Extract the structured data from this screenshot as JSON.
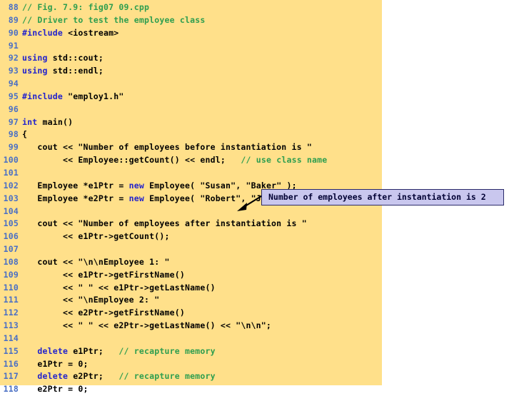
{
  "page": {
    "background_color": "#ffffff",
    "code_background_color": "#ffe08a",
    "linenum_color": "#4a6fc4",
    "keyword_color": "#2222cc",
    "comment_color": "#2e9e4f",
    "text_color": "#000000"
  },
  "callout": {
    "text": "Number of employees after instantiation is 2",
    "background_color": "#c9c7ee",
    "border_color": "#2a2a6a",
    "text_color": "#000033"
  },
  "code": {
    "lines": [
      {
        "number": "88",
        "tokens": [
          {
            "t": "// Fig. 7.9: fig07 09.cpp",
            "c": "cmt"
          }
        ]
      },
      {
        "number": "89",
        "tokens": [
          {
            "t": "// Driver to test the employee class",
            "c": "cmt"
          }
        ]
      },
      {
        "number": "90",
        "tokens": [
          {
            "t": "#include",
            "c": "pre"
          },
          {
            "t": " <iostream>",
            "c": "plain"
          }
        ]
      },
      {
        "number": "91",
        "tokens": []
      },
      {
        "number": "92",
        "tokens": [
          {
            "t": "using",
            "c": "kw"
          },
          {
            "t": " std::cout;",
            "c": "plain"
          }
        ]
      },
      {
        "number": "93",
        "tokens": [
          {
            "t": "using",
            "c": "kw"
          },
          {
            "t": " std::endl;",
            "c": "plain"
          }
        ]
      },
      {
        "number": "94",
        "tokens": []
      },
      {
        "number": "95",
        "tokens": [
          {
            "t": "#include",
            "c": "pre"
          },
          {
            "t": " \"employ1.h\"",
            "c": "plain"
          }
        ]
      },
      {
        "number": "96",
        "tokens": []
      },
      {
        "number": "97",
        "tokens": [
          {
            "t": "int",
            "c": "kw"
          },
          {
            "t": " main()",
            "c": "plain"
          }
        ]
      },
      {
        "number": "98",
        "tokens": [
          {
            "t": "{",
            "c": "plain"
          }
        ]
      },
      {
        "number": "99",
        "tokens": [
          {
            "t": "   cout << \"Number of employees before instantiation is \"",
            "c": "plain"
          }
        ]
      },
      {
        "number": "100",
        "tokens": [
          {
            "t": "        << Employee::getCount() << endl;   ",
            "c": "plain"
          },
          {
            "t": "// use class name",
            "c": "cmt"
          }
        ]
      },
      {
        "number": "101",
        "tokens": []
      },
      {
        "number": "102",
        "tokens": [
          {
            "t": "   Employee *e1Ptr = ",
            "c": "plain"
          },
          {
            "t": "new",
            "c": "kw"
          },
          {
            "t": " Employee( \"Susan\", \"Baker\" );",
            "c": "plain"
          }
        ]
      },
      {
        "number": "103",
        "tokens": [
          {
            "t": "   Employee *e2Ptr = ",
            "c": "plain"
          },
          {
            "t": "new",
            "c": "kw"
          },
          {
            "t": " Employee( \"Robert\", \"Jones\" );",
            "c": "plain"
          }
        ]
      },
      {
        "number": "104",
        "tokens": []
      },
      {
        "number": "105",
        "tokens": [
          {
            "t": "   cout << \"Number of employees after instantiation is \"",
            "c": "plain"
          }
        ]
      },
      {
        "number": "106",
        "tokens": [
          {
            "t": "        << e1Ptr->getCount();",
            "c": "plain"
          }
        ]
      },
      {
        "number": "107",
        "tokens": []
      },
      {
        "number": "108",
        "tokens": [
          {
            "t": "   cout << \"\\n\\nEmployee 1: \"",
            "c": "plain"
          }
        ]
      },
      {
        "number": "109",
        "tokens": [
          {
            "t": "        << e1Ptr->getFirstName()",
            "c": "plain"
          }
        ]
      },
      {
        "number": "110",
        "tokens": [
          {
            "t": "        << \" \" << e1Ptr->getLastName()",
            "c": "plain"
          }
        ]
      },
      {
        "number": "111",
        "tokens": [
          {
            "t": "        << \"\\nEmployee 2: \"",
            "c": "plain"
          }
        ]
      },
      {
        "number": "112",
        "tokens": [
          {
            "t": "        << e2Ptr->getFirstName()",
            "c": "plain"
          }
        ]
      },
      {
        "number": "113",
        "tokens": [
          {
            "t": "        << \" \" << e2Ptr->getLastName() << \"\\n\\n\";",
            "c": "plain"
          }
        ]
      },
      {
        "number": "114",
        "tokens": []
      },
      {
        "number": "115",
        "tokens": [
          {
            "t": "   ",
            "c": "plain"
          },
          {
            "t": "delete",
            "c": "kw"
          },
          {
            "t": " e1Ptr;   ",
            "c": "plain"
          },
          {
            "t": "// recapture memory",
            "c": "cmt"
          }
        ]
      },
      {
        "number": "116",
        "tokens": [
          {
            "t": "   e1Ptr = 0;",
            "c": "plain"
          }
        ]
      },
      {
        "number": "117",
        "tokens": [
          {
            "t": "   ",
            "c": "plain"
          },
          {
            "t": "delete",
            "c": "kw"
          },
          {
            "t": " e2Ptr;   ",
            "c": "plain"
          },
          {
            "t": "// recapture memory",
            "c": "cmt"
          }
        ]
      },
      {
        "number": "118",
        "tokens": [
          {
            "t": "   e2Ptr = 0;",
            "c": "plain"
          }
        ]
      }
    ]
  }
}
